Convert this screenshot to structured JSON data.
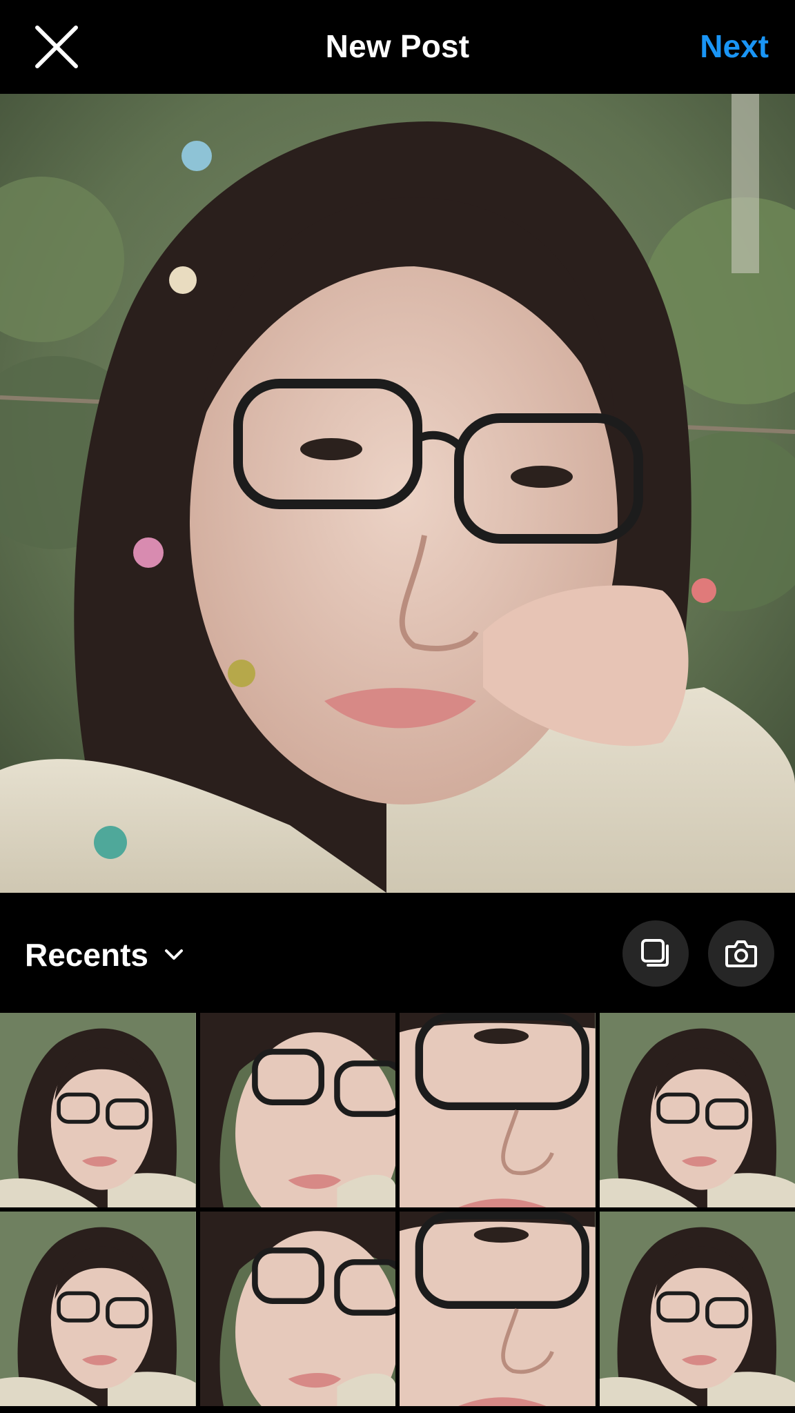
{
  "header": {
    "title": "New Post",
    "next_label": "Next",
    "close_icon": "close-icon"
  },
  "recents": {
    "label": "Recents",
    "chevron_icon": "chevron-down-icon",
    "multi_select_icon": "multi-select-icon",
    "camera_icon": "camera-icon"
  },
  "colors": {
    "accent": "#1a95f5",
    "background": "#000000",
    "button_bg": "#262626"
  },
  "gallery": {
    "thumbnails": [
      {
        "variant": "full"
      },
      {
        "variant": "closer"
      },
      {
        "variant": "eye-closeup"
      },
      {
        "variant": "full"
      },
      {
        "variant": "full"
      },
      {
        "variant": "closer"
      },
      {
        "variant": "eye-closeup"
      },
      {
        "variant": "full"
      }
    ]
  }
}
